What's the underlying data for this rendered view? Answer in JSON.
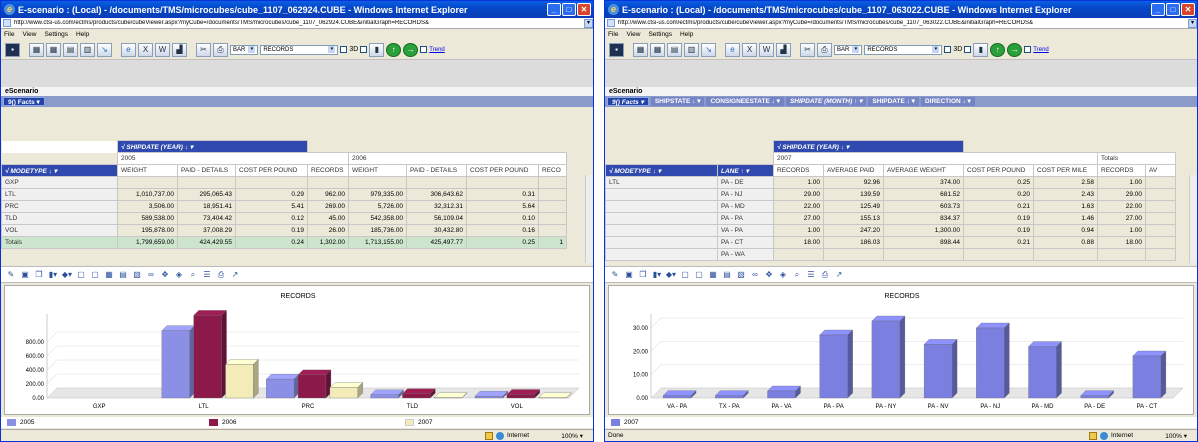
{
  "left": {
    "title": "E-scenario : (Local) - /documents/TMS/microcubes/cube_1107_062924.CUBE - Windows Internet Explorer",
    "address": "http://www.ctsi-us.com/ectms/products/cube/cubeViewer.aspx?myCube=/documents/TMS/microcubes/cube_1107_062924.CUBE&initialGraph=RECORDS&",
    "menu": [
      "File",
      "View",
      "Settings",
      "Help"
    ],
    "chart_type_select": "BAR",
    "measure_select": "RECORDS",
    "three_d_label": "3D",
    "trend_label": "Trend",
    "escenario_label": "eScenario",
    "facts_label": "9() Facts",
    "col_dim_label": "SHIPDATE (YEAR)",
    "row_dim_label": "MODETYPE",
    "years": [
      "2005",
      "2006"
    ],
    "measures": [
      "WEIGHT",
      "PAID - DETAILS",
      "COST PER POUND",
      "RECORDS"
    ],
    "measures_trunc": "RECO",
    "rows": [
      {
        "label": "GXP",
        "v": [
          "",
          "",
          "",
          "",
          "",
          "",
          "",
          ""
        ]
      },
      {
        "label": "LTL",
        "v": [
          "1,010,737.00",
          "295,065.43",
          "0.29",
          "962.00",
          "979,335.00",
          "306,643.62",
          "0.31",
          ""
        ]
      },
      {
        "label": "PRC",
        "v": [
          "3,506.00",
          "18,951.41",
          "5.41",
          "269.00",
          "5,726.00",
          "32,312.31",
          "5.64",
          ""
        ]
      },
      {
        "label": "TLD",
        "v": [
          "589,538.00",
          "73,404.42",
          "0.12",
          "45.00",
          "542,358.00",
          "56,109.04",
          "0.10",
          ""
        ]
      },
      {
        "label": "VOL",
        "v": [
          "195,878.00",
          "37,008.29",
          "0.19",
          "26.00",
          "185,736.00",
          "30,432.80",
          "0.16",
          ""
        ]
      }
    ],
    "totals": {
      "label": "Totals",
      "v": [
        "1,799,659.00",
        "424,429.55",
        "0.24",
        "1,302.00",
        "1,713,155.00",
        "425,497.77",
        "0.25",
        "1"
      ]
    },
    "status_zone": "Internet",
    "status_zoom": "100%"
  },
  "right": {
    "title": "E-scenario : (Local) - /documents/TMS/microcubes/cube_1107_063022.CUBE - Windows Internet Explorer",
    "address": "http://www.ctsi-us.com/ectms/products/cube/cubeViewer.aspx?myCube=/documents/TMS/microcubes/cube_1107_063022.CUBE&initialGraph=RECORDS&",
    "menu": [
      "File",
      "View",
      "Settings",
      "Help"
    ],
    "chart_type_select": "BAR",
    "measure_select": "RECORDS",
    "three_d_label": "3D",
    "trend_label": "Trend",
    "escenario_label": "eScenario",
    "facts_label": "9() Facts",
    "dims": [
      "SHIPSTATE",
      "CONSIGNEESTATE",
      "SHIPDATE (MONTH)",
      "SHIPDATE",
      "DIRECTION"
    ],
    "col_dim_label": "SHIPDATE (YEAR)",
    "row_dim_label": "MODETYPE",
    "row_dim2_label": "LANE",
    "year": "2007",
    "totals_label": "Totals",
    "measures": [
      "RECORDS",
      "AVERAGE PAID",
      "AVERAGE WEIGHT",
      "COST PER POUND",
      "COST PER MILE",
      "RECORDS",
      "AV"
    ],
    "mode_label": "LTL",
    "rows": [
      {
        "lane": "PA - DE",
        "v": [
          "1.00",
          "92.96",
          "374.00",
          "0.25",
          "2.58",
          "1.00"
        ]
      },
      {
        "lane": "PA - NJ",
        "v": [
          "29.00",
          "139.59",
          "681.52",
          "0.20",
          "2.43",
          "29.00"
        ]
      },
      {
        "lane": "PA - MD",
        "v": [
          "22.00",
          "125.49",
          "603.73",
          "0.21",
          "1.63",
          "22.00"
        ]
      },
      {
        "lane": "PA - PA",
        "v": [
          "27.00",
          "155.13",
          "834.37",
          "0.19",
          "1.46",
          "27.00"
        ]
      },
      {
        "lane": "VA - PA",
        "v": [
          "1.00",
          "247.20",
          "1,300.00",
          "0.19",
          "0.94",
          "1.00"
        ]
      },
      {
        "lane": "PA - CT",
        "v": [
          "18.00",
          "186.03",
          "898.44",
          "0.21",
          "0.88",
          "18.00"
        ]
      },
      {
        "lane": "PA - WA",
        "v": [
          "",
          "",
          "",
          "",
          "",
          ""
        ]
      }
    ],
    "status_left": "Done",
    "status_zone": "Internet",
    "status_zoom": "100%"
  },
  "chart_data": [
    {
      "type": "bar",
      "title": "RECORDS",
      "categories": [
        "GXP",
        "LTL",
        "PRC",
        "TLD",
        "VOL"
      ],
      "series": [
        {
          "name": "2005",
          "values": [
            0,
            962,
            269,
            45,
            26
          ],
          "color": "#8b8fe6"
        },
        {
          "name": "2006",
          "values": [
            0,
            1180,
            330,
            60,
            50
          ],
          "color": "#8b1a4a"
        },
        {
          "name": "2007",
          "values": [
            0,
            480,
            150,
            5,
            3
          ],
          "color": "#f3ecb8"
        }
      ],
      "yticks": [
        "0.00",
        "200.00",
        "400.00",
        "600.00",
        "800.00"
      ],
      "ylim": [
        0,
        1200
      ],
      "legend": "bottom"
    },
    {
      "type": "bar",
      "title": "RECORDS",
      "categories": [
        "VA - PA",
        "TX - PA",
        "PA - VA",
        "PA - PA",
        "PA - NY",
        "PA - NV",
        "PA - NJ",
        "PA - MD",
        "PA - DE",
        "PA - CT"
      ],
      "series": [
        {
          "name": "2007",
          "values": [
            1,
            1,
            3,
            27,
            33,
            23,
            30,
            22,
            1,
            18
          ],
          "color": "#7b7fe0"
        }
      ],
      "yticks": [
        "0.00",
        "10.00",
        "20.00",
        "30.00"
      ],
      "ylim": [
        0,
        36
      ],
      "legend": "bottom"
    }
  ]
}
